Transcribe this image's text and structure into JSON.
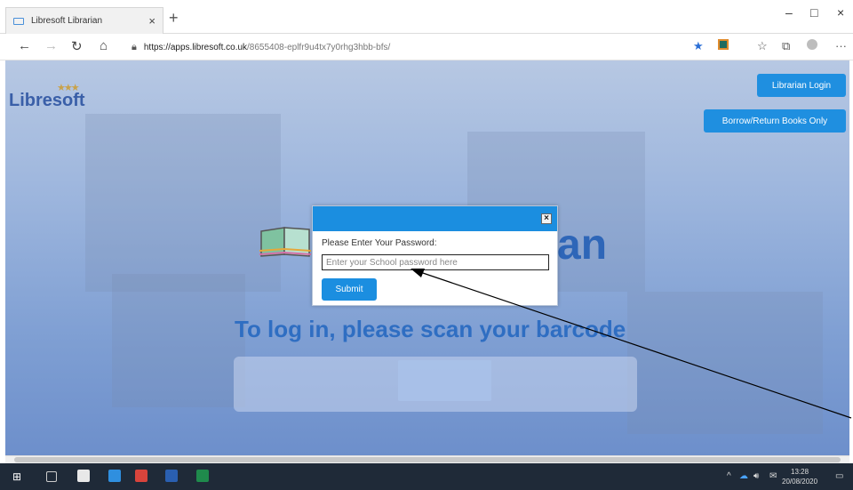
{
  "browser": {
    "tab_title": "Libresoft Librarian",
    "tab_close": "×",
    "new_tab": "+",
    "url_host": "https://apps.libresoft.co.uk",
    "url_path": "/8655408-eplfr9u4tx7y0rhg3hbb-bfs/",
    "window_controls": [
      "–",
      "□",
      "×"
    ]
  },
  "page": {
    "logo": "Libresoft",
    "librarian_login": "Librarian Login",
    "borrow_return": "Borrow/Return Books Only",
    "title_partial": "an",
    "scan_prompt": "To log in, please scan your barcode"
  },
  "modal": {
    "close": "×",
    "label": "Please Enter Your Password:",
    "placeholder": "Enter your School password here",
    "submit": "Submit"
  },
  "taskbar": {
    "time": "13:28",
    "date": "20/08/2020"
  },
  "colors": {
    "accent": "#1b8ee0",
    "title_blue": "#2e66b8",
    "taskbar": "#1f2a38"
  }
}
